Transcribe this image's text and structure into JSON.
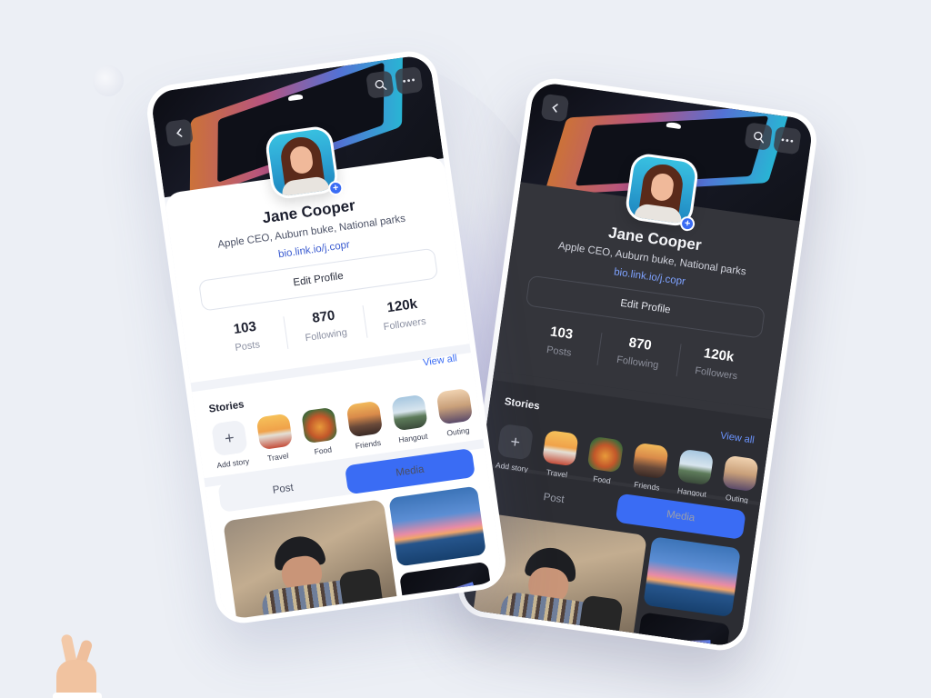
{
  "profile": {
    "name": "Jane Cooper",
    "bio": "Apple CEO,  Auburn buke,  National parks",
    "link": "bio.link.io/j.copr",
    "edit_label": "Edit Profile",
    "add_badge": "+"
  },
  "stats": [
    {
      "value": "103",
      "label": "Posts"
    },
    {
      "value": "870",
      "label": "Following"
    },
    {
      "value": "120k",
      "label": "Followers"
    }
  ],
  "stories": {
    "title": "Stories",
    "view_all": "View all",
    "add_label": "Add story",
    "add_glyph": "+",
    "items": [
      {
        "label": "Travel"
      },
      {
        "label": "Food"
      },
      {
        "label": "Friends"
      },
      {
        "label": "Hangout"
      },
      {
        "label": "Outing"
      }
    ]
  },
  "tabs": [
    {
      "label": "Post",
      "active": false
    },
    {
      "label": "Media",
      "active": true
    }
  ],
  "icons": {
    "back": "chevron-left-icon",
    "search": "search-icon",
    "more": "more-icon"
  },
  "colors": {
    "accent": "#3a6cf4",
    "link_light": "#3a5bd0",
    "link_dark": "#7ea2ff",
    "dark_bg": "#2a2b30",
    "light_bg": "#ffffff"
  }
}
